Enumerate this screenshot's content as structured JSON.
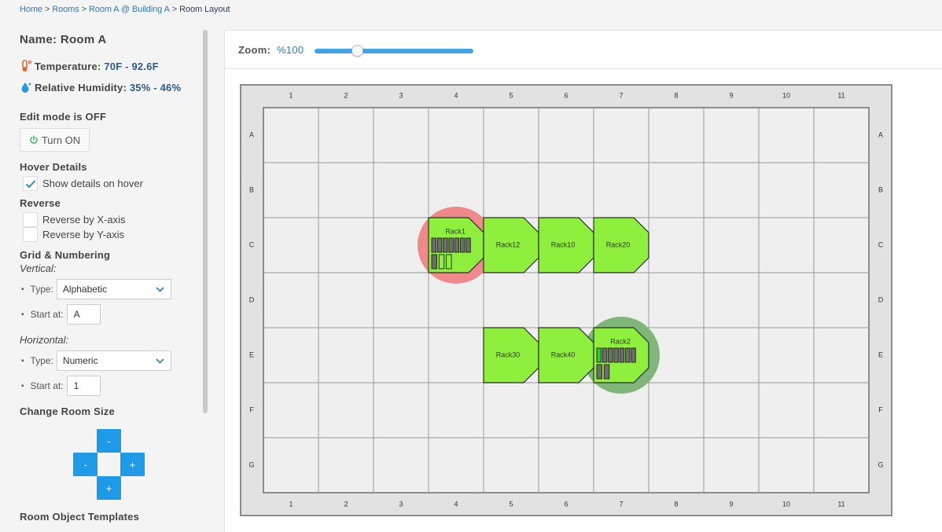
{
  "breadcrumb": {
    "items": [
      "Home",
      "Rooms",
      "Room A @ Building A"
    ],
    "current": "Room Layout",
    "separator": ">"
  },
  "room": {
    "name_label": "Name: Room A",
    "temperature_label": "Temperature:",
    "temperature_value": "70F - 92.6F",
    "humidity_label": "Relative Humidity:",
    "humidity_value": "35% - 46%"
  },
  "edit_mode": {
    "title": "Edit mode is OFF",
    "button_label": "Turn ON"
  },
  "hover_details": {
    "title": "Hover Details",
    "option_label": "Show details on hover",
    "checked": true
  },
  "reverse": {
    "title": "Reverse",
    "x_label": "Reverse by X-axis",
    "y_label": "Reverse by Y-axis"
  },
  "grid_numbering": {
    "title": "Grid & Numbering",
    "vertical_label": "Vertical:",
    "horizontal_label": "Horizontal:",
    "type_label": "Type:",
    "start_label": "Start at:",
    "vertical_type": "Alphabetic",
    "vertical_start": "A",
    "horizontal_type": "Numeric",
    "horizontal_start": "1"
  },
  "room_size": {
    "title": "Change Room Size",
    "minus_label": "-",
    "plus_label": "+"
  },
  "templates": {
    "title": "Room Object Templates"
  },
  "zoom": {
    "label": "Zoom:",
    "value": "%100",
    "level": 0.27
  },
  "grid": {
    "columns": [
      "1",
      "2",
      "3",
      "4",
      "5",
      "6",
      "7",
      "8",
      "9",
      "10",
      "11"
    ],
    "rows": [
      "A",
      "B",
      "C",
      "D",
      "E",
      "F",
      "G"
    ]
  },
  "racks": [
    {
      "name": "Rack1",
      "row": "C",
      "col": "4",
      "detailed": true,
      "alert": "red",
      "units_top": [
        0,
        0,
        0,
        0,
        0,
        0,
        0
      ],
      "units_bottom": [
        0,
        1,
        1
      ]
    },
    {
      "name": "Rack12",
      "row": "C",
      "col": "5",
      "detailed": false
    },
    {
      "name": "Rack10",
      "row": "C",
      "col": "6",
      "detailed": false
    },
    {
      "name": "Rack20",
      "row": "C",
      "col": "7",
      "detailed": false
    },
    {
      "name": "Rack30",
      "row": "E",
      "col": "5",
      "detailed": false
    },
    {
      "name": "Rack40",
      "row": "E",
      "col": "6",
      "detailed": false
    },
    {
      "name": "Rack2",
      "row": "E",
      "col": "7",
      "detailed": true,
      "alert": "green",
      "units_top": [
        2,
        0,
        0,
        0,
        0,
        0,
        0
      ],
      "units_bottom": [
        0,
        0
      ]
    }
  ],
  "colors": {
    "rack_fill": "#8ef03c",
    "alert_red": "#f08a8a",
    "alert_green": "#7fb77b",
    "accent": "#1d9be6"
  }
}
